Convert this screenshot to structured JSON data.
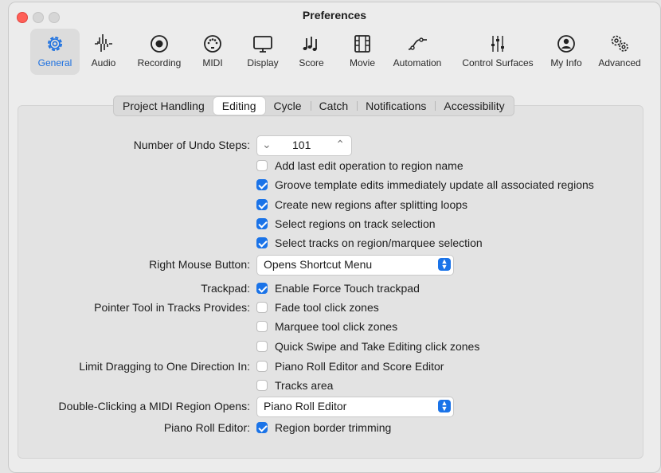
{
  "window": {
    "title": "Preferences"
  },
  "toolbar": {
    "items": [
      {
        "label": "General",
        "icon": "gear-icon",
        "active": true
      },
      {
        "label": "Audio",
        "icon": "waveform-icon"
      },
      {
        "label": "Recording",
        "icon": "record-icon"
      },
      {
        "label": "MIDI",
        "icon": "midi-port-icon"
      },
      {
        "label": "Display",
        "icon": "monitor-icon"
      },
      {
        "label": "Score",
        "icon": "music-notes-icon"
      },
      {
        "label": "Movie",
        "icon": "film-icon"
      },
      {
        "label": "Automation",
        "icon": "automation-curve-icon"
      },
      {
        "label": "Control Surfaces",
        "icon": "faders-icon"
      },
      {
        "label": "My Info",
        "icon": "person-icon"
      },
      {
        "label": "Advanced",
        "icon": "gears-icon"
      }
    ]
  },
  "tabs": [
    {
      "label": "Project Handling"
    },
    {
      "label": "Editing",
      "active": true
    },
    {
      "label": "Cycle"
    },
    {
      "label": "Catch"
    },
    {
      "label": "Notifications"
    },
    {
      "label": "Accessibility"
    }
  ],
  "settings": {
    "undo_label": "Number of Undo Steps:",
    "undo_value": "101",
    "undo_decrement": "⌄",
    "undo_increment": "⌃",
    "add_last_edit": {
      "label": "Add last edit operation to region name",
      "checked": false
    },
    "groove_template": {
      "label": "Groove template edits immediately update all associated regions",
      "checked": true
    },
    "create_regions": {
      "label": "Create new regions after splitting loops",
      "checked": true
    },
    "select_regions": {
      "label": "Select regions on track selection",
      "checked": true
    },
    "select_tracks": {
      "label": "Select tracks on region/marquee selection",
      "checked": true
    },
    "right_mouse_label": "Right Mouse Button:",
    "right_mouse_value": "Opens Shortcut Menu",
    "trackpad_label": "Trackpad:",
    "force_touch": {
      "label": "Enable Force Touch trackpad",
      "checked": true
    },
    "pointer_label": "Pointer Tool in Tracks Provides:",
    "fade_zones": {
      "label": "Fade tool click zones",
      "checked": false
    },
    "marquee_zones": {
      "label": "Marquee tool click zones",
      "checked": false
    },
    "quick_swipe": {
      "label": "Quick Swipe and Take Editing click zones",
      "checked": false
    },
    "limit_label": "Limit Dragging to One Direction In:",
    "piano_score": {
      "label": "Piano Roll Editor and Score Editor",
      "checked": false
    },
    "tracks_area": {
      "label": "Tracks area",
      "checked": false
    },
    "double_click_label": "Double-Clicking a MIDI Region Opens:",
    "double_click_value": "Piano Roll Editor",
    "piano_roll_label": "Piano Roll Editor:",
    "border_trimming": {
      "label": "Region border trimming",
      "checked": true
    }
  },
  "colors": {
    "accent": "#1a73e8",
    "close": "#ff5f57"
  }
}
